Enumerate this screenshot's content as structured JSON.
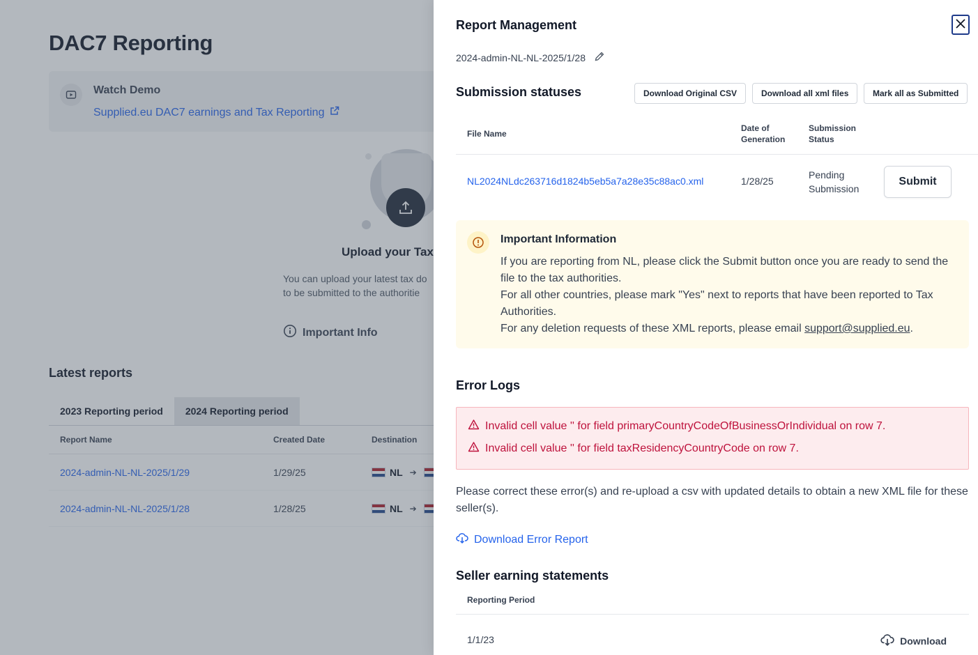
{
  "page": {
    "title": "DAC7 Reporting",
    "demo": {
      "title": "Watch Demo",
      "link": "Supplied.eu DAC7 earnings and Tax Reporting"
    },
    "upload": {
      "title": "Upload your Tax d",
      "desc_line1": "You can upload your latest tax do",
      "desc_line2": "to be submitted to the authoritie"
    },
    "important_info": "Important Info",
    "latest_reports": {
      "title": "Latest reports",
      "tabs": [
        "2023 Reporting period",
        "2024 Reporting period"
      ],
      "columns": [
        "Report Name",
        "Created Date",
        "Destination"
      ],
      "rows": [
        {
          "name": "2024-admin-NL-NL-2025/1/29",
          "date": "1/29/25",
          "from": "NL"
        },
        {
          "name": "2024-admin-NL-NL-2025/1/28",
          "date": "1/28/25",
          "from": "NL"
        }
      ]
    }
  },
  "drawer": {
    "title": "Report Management",
    "report_name": "2024-admin-NL-NL-2025/1/28",
    "submission": {
      "title": "Submission statuses",
      "buttons": [
        "Download Original CSV",
        "Download all xml files",
        "Mark all as Submitted"
      ],
      "columns": {
        "file_name": "File Name",
        "date_line1": "Date of",
        "date_line2": "Generation",
        "status_line1": "Submission",
        "status_line2": "Status"
      },
      "row": {
        "file": "NL2024NLdc263716d1824b5eb5a7a28e35c88ac0.xml",
        "date": "1/28/25",
        "status_line1": "Pending",
        "status_line2": "Submission",
        "action": "Submit"
      }
    },
    "info": {
      "title": "Important Information",
      "line1": "If you are reporting from NL, please click the Submit button once you are ready to send the file to the tax authorities.",
      "line2": "For all other countries, please mark \"Yes\" next to reports that have been reported to Tax Authorities.",
      "line3_prefix": "For any deletion requests of these XML reports, please email ",
      "email": "support@supplied.eu",
      "line3_suffix": "."
    },
    "errors": {
      "title": "Error Logs",
      "items": [
        "Invalid cell value '' for field primaryCountryCodeOfBusinessOrIndividual on row 7.",
        "Invalid cell value '' for field taxResidencyCountryCode on row 7."
      ],
      "help": "Please correct these error(s) and re-upload a csv with updated details to obtain a new XML file for these seller(s).",
      "download": "Download Error Report"
    },
    "seller": {
      "title": "Seller earning statements",
      "column": "Reporting Period",
      "row": {
        "period": "1/1/23",
        "action": "Download"
      }
    }
  },
  "colors": {
    "link": "#2563eb",
    "error": "#be123c",
    "info_bg": "#fffbeb",
    "error_bg": "#fdecee"
  }
}
